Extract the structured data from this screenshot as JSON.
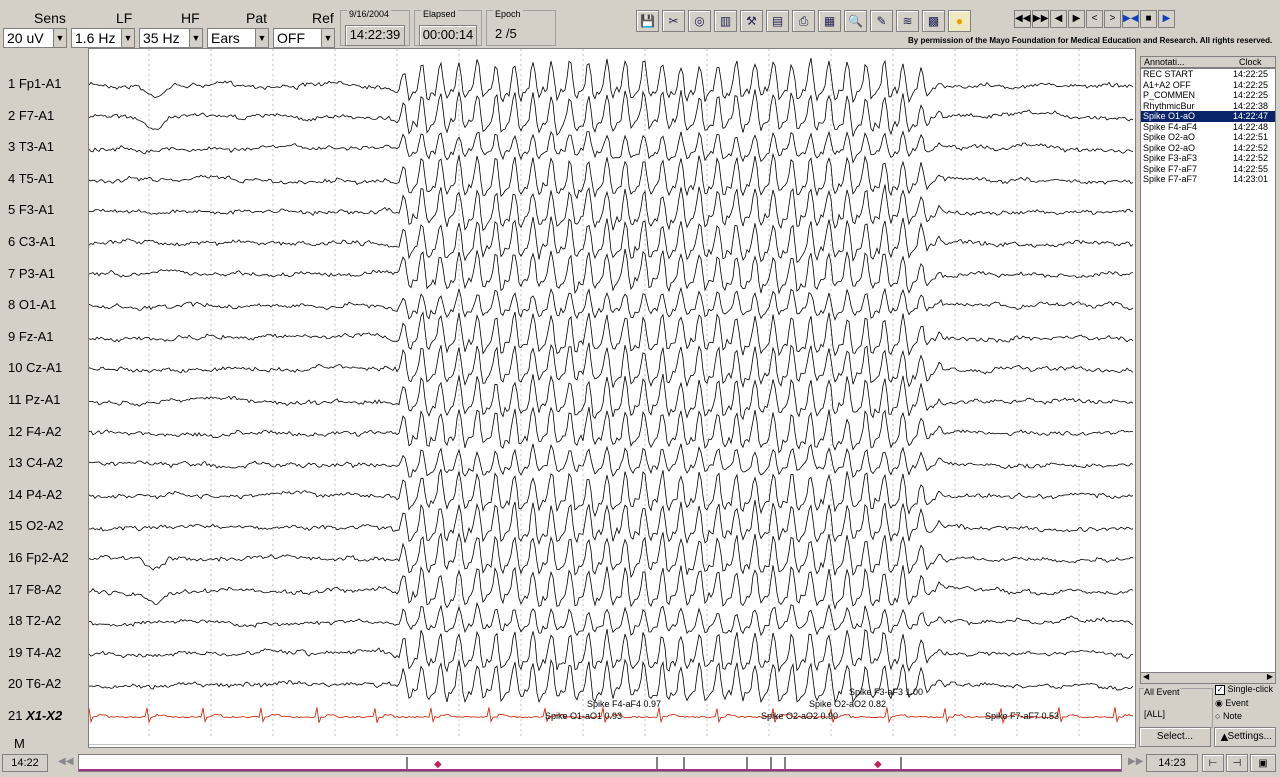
{
  "header": {
    "sens_label": "Sens",
    "lf_label": "LF",
    "hf_label": "HF",
    "pat_label": "Pat",
    "ref_label": "Ref",
    "sens_value": "20 uV",
    "lf_value": "1.6 Hz",
    "hf_value": "35 Hz",
    "pat_value": "Ears",
    "ref_value": "OFF",
    "date": "9/16/2004",
    "time": "14:22:39",
    "elapsed_label": "Elapsed",
    "elapsed": "00:00:14",
    "epoch_label": "Epoch",
    "epoch": "2 /5",
    "credit": "By permission of the Mayo Foundation for Medical Education and Research. All rights reserved."
  },
  "toolbar": {
    "icons": [
      "save-icon",
      "scissors-icon",
      "brain-icon",
      "histogram-icon",
      "hammer-icon",
      "page-icon",
      "print-icon",
      "chart-icon",
      "magnifier-icon",
      "pencil-icon",
      "montage-icon",
      "photic-icon",
      "video-icon"
    ],
    "nav_glyphs": [
      "◀◀",
      "▶▶",
      "◀",
      "▶",
      "<",
      ">",
      "▶◀",
      "■",
      "▶"
    ]
  },
  "channels": [
    "1 Fp1-A1",
    "2 F7-A1",
    "3 T3-A1",
    "4 T5-A1",
    "5 F3-A1",
    "6 C3-A1",
    "7 P3-A1",
    "8 O1-A1",
    "9 Fz-A1",
    "10 Cz-A1",
    "11 Pz-A1",
    "12 F4-A2",
    "13 C4-A2",
    "14 P4-A2",
    "15 O2-A2",
    "16 Fp2-A2",
    "17 F8-A2",
    "18 T2-A2",
    "19 T4-A2",
    "20 T6-A2"
  ],
  "ekg_channel": {
    "num": "21",
    "name": "X1-X2"
  },
  "marker_channel": "M",
  "spike_labels": [
    "Spike F4-aF4 0.97",
    "Spike O1-aO1 0.93",
    "Spike F3-aF3 1.00",
    "Spike O2-aO2 0.82",
    "Spike O2-aO2 0.90",
    "Spike F7-aF7 0.53"
  ],
  "annotations": {
    "col_name": "Annotati...",
    "col_clock": "Clock",
    "rows": [
      {
        "name": "REC START",
        "time": "14:22:25"
      },
      {
        "name": "A1+A2 OFF",
        "time": "14:22:25"
      },
      {
        "name": "P_COMMEN",
        "time": "14:22:25"
      },
      {
        "name": "RhythmicBur",
        "time": "14:22:38"
      },
      {
        "name": "Spike O1-aO",
        "time": "14:22:47",
        "selected": true
      },
      {
        "name": "Spike F4-aF4",
        "time": "14:22:48"
      },
      {
        "name": "Spike O2-aO",
        "time": "14:22:51"
      },
      {
        "name": "Spike O2-aO",
        "time": "14:22:52"
      },
      {
        "name": "Spike F3-aF3",
        "time": "14:22:52"
      },
      {
        "name": "Spike F7-aF7",
        "time": "14:22:55"
      },
      {
        "name": "Spike F7-aF7",
        "time": "14:23:01"
      }
    ]
  },
  "controls": {
    "all_event_label": "All Event",
    "all_value": "[ALL]",
    "single_click": "Single-click",
    "event": "Event",
    "note": "Note",
    "select_btn": "Select...",
    "settings_btn": "Settings..."
  },
  "status": {
    "left_time": "14:22",
    "right_time": "14:23"
  },
  "colors": {
    "trace": "#000000",
    "ekg": "#d03010",
    "selection": "#0a246a",
    "background": "#d4d0c8"
  }
}
